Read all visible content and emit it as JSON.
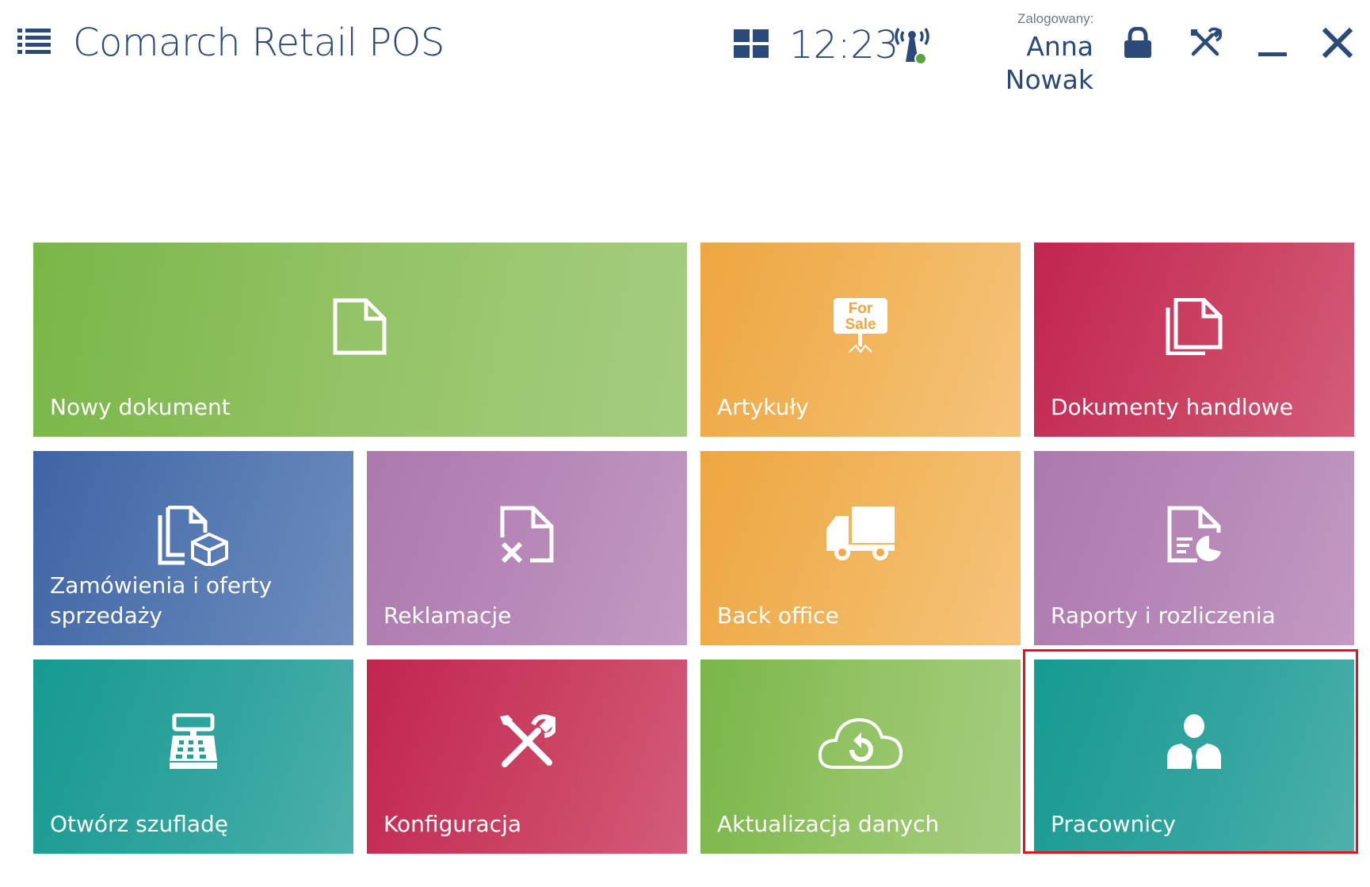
{
  "header": {
    "app_title": "Comarch Retail POS",
    "time": "12:23",
    "logged_label": "Zalogowany:",
    "user_name": "Anna Nowak",
    "icons": [
      "menu-icon",
      "tiles-icon",
      "signal-icon",
      "lock-icon",
      "tools-icon",
      "minimize-icon",
      "close-icon"
    ]
  },
  "tiles": [
    {
      "label": "Nowy dokument",
      "color": "#7ab648",
      "icon": "document-icon"
    },
    {
      "label": "Artykuły",
      "color": "#eea640",
      "icon": "for-sale-sign-icon",
      "icon_text_1": "For",
      "icon_text_2": "Sale"
    },
    {
      "label": "Dokumenty handlowe",
      "color": "#c1254f",
      "icon": "documents-icon"
    },
    {
      "label": "Zamówienia i oferty sprzedaży",
      "color": "#3e64a4",
      "icon": "documents-box-icon"
    },
    {
      "label": "Reklamacje",
      "color": "#ac79ad",
      "icon": "document-cancel-icon"
    },
    {
      "label": "Back office",
      "color": "#eea640",
      "icon": "truck-icon"
    },
    {
      "label": "Raporty i rozliczenia",
      "color": "#ac79ad",
      "icon": "report-chart-icon"
    },
    {
      "label": "Otwórz szufladę",
      "color": "#169a91",
      "icon": "cash-register-icon"
    },
    {
      "label": "Konfiguracja",
      "color": "#c1254f",
      "icon": "tools-icon"
    },
    {
      "label": "Aktualizacja danych",
      "color": "#7ab648",
      "icon": "cloud-sync-icon"
    },
    {
      "label": "Pracownicy",
      "color": "#169a91",
      "icon": "employee-icon",
      "selected": true
    }
  ],
  "colors": {
    "header_text": "#2b4a7a",
    "highlight": "#e3141f"
  }
}
